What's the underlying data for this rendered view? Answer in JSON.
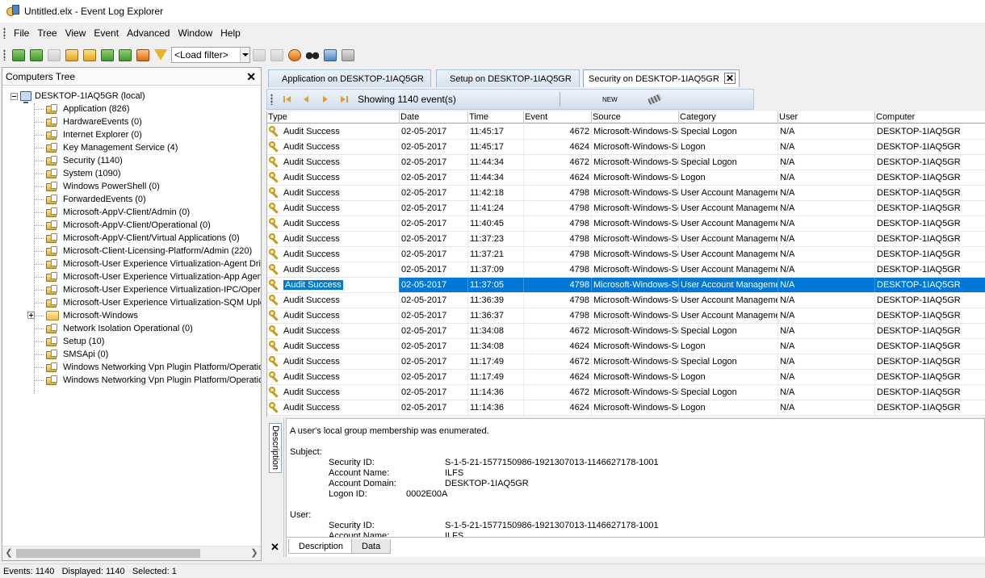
{
  "window": {
    "title": "Untitled.elx - Event Log Explorer"
  },
  "menu": [
    "File",
    "Tree",
    "View",
    "Event",
    "Advanced",
    "Window",
    "Help"
  ],
  "toolbar": {
    "load_filter": "<Load filter>",
    "icons": [
      "add-computer-icon",
      "add-log-icon",
      "remove-icon",
      "open-log-icon",
      "open-folder-icon",
      "save-icon",
      "save-as-icon",
      "delete-icon",
      "filter-icon",
      "clear-filter-icon",
      "clear-log-icon",
      "refresh-icon",
      "find-icon",
      "find-next-icon",
      "print-icon"
    ]
  },
  "computers_tree": {
    "title": "Computers Tree",
    "root": "DESKTOP-1IAQ5GR (local)",
    "items": [
      {
        "label": "Application (826)",
        "kind": "log"
      },
      {
        "label": "HardwareEvents (0)",
        "kind": "log"
      },
      {
        "label": "Internet Explorer (0)",
        "kind": "log"
      },
      {
        "label": "Key Management Service (4)",
        "kind": "log"
      },
      {
        "label": "Security (1140)",
        "kind": "log"
      },
      {
        "label": "System (1090)",
        "kind": "log"
      },
      {
        "label": "Windows PowerShell (0)",
        "kind": "log"
      },
      {
        "label": "ForwardedEvents (0)",
        "kind": "log"
      },
      {
        "label": "Microsoft-AppV-Client/Admin (0)",
        "kind": "log"
      },
      {
        "label": "Microsoft-AppV-Client/Operational (0)",
        "kind": "log"
      },
      {
        "label": "Microsoft-AppV-Client/Virtual Applications (0)",
        "kind": "log"
      },
      {
        "label": "Microsoft-Client-Licensing-Platform/Admin (220)",
        "kind": "log"
      },
      {
        "label": "Microsoft-User Experience Virtualization-Agent Driver",
        "kind": "log"
      },
      {
        "label": "Microsoft-User Experience Virtualization-App Agent/C",
        "kind": "log"
      },
      {
        "label": "Microsoft-User Experience Virtualization-IPC/Operatic",
        "kind": "log"
      },
      {
        "label": "Microsoft-User Experience Virtualization-SQM Uploade",
        "kind": "log"
      },
      {
        "label": "Microsoft-Windows",
        "kind": "folder"
      },
      {
        "label": "Network Isolation Operational (0)",
        "kind": "log"
      },
      {
        "label": "Setup (10)",
        "kind": "log"
      },
      {
        "label": "SMSApi (0)",
        "kind": "log"
      },
      {
        "label": "Windows Networking Vpn Plugin Platform/Operational",
        "kind": "log"
      },
      {
        "label": "Windows Networking Vpn Plugin Platform/Operational",
        "kind": "log"
      }
    ]
  },
  "tabs": [
    {
      "label": "Application on DESKTOP-1IAQ5GR",
      "active": false
    },
    {
      "label": "Setup on DESKTOP-1IAQ5GR",
      "active": false
    },
    {
      "label": "Security on DESKTOP-1IAQ5GR",
      "active": true
    }
  ],
  "event_bar": {
    "showing": "Showing 1140 event(s)",
    "new_label": "NEW"
  },
  "columns": [
    "Type",
    "Date",
    "Time",
    "Event",
    "Source",
    "Category",
    "User",
    "Computer"
  ],
  "events": [
    {
      "type": "Audit Success",
      "date": "02-05-2017",
      "time": "11:45:17",
      "event": "4672",
      "source": "Microsoft-Windows-Se",
      "category": "Special Logon",
      "user": "N/A",
      "computer": "DESKTOP-1IAQ5GR"
    },
    {
      "type": "Audit Success",
      "date": "02-05-2017",
      "time": "11:45:17",
      "event": "4624",
      "source": "Microsoft-Windows-Se",
      "category": "Logon",
      "user": "N/A",
      "computer": "DESKTOP-1IAQ5GR"
    },
    {
      "type": "Audit Success",
      "date": "02-05-2017",
      "time": "11:44:34",
      "event": "4672",
      "source": "Microsoft-Windows-Se",
      "category": "Special Logon",
      "user": "N/A",
      "computer": "DESKTOP-1IAQ5GR"
    },
    {
      "type": "Audit Success",
      "date": "02-05-2017",
      "time": "11:44:34",
      "event": "4624",
      "source": "Microsoft-Windows-Se",
      "category": "Logon",
      "user": "N/A",
      "computer": "DESKTOP-1IAQ5GR"
    },
    {
      "type": "Audit Success",
      "date": "02-05-2017",
      "time": "11:42:18",
      "event": "4798",
      "source": "Microsoft-Windows-Se",
      "category": "User Account Manageme",
      "user": "N/A",
      "computer": "DESKTOP-1IAQ5GR"
    },
    {
      "type": "Audit Success",
      "date": "02-05-2017",
      "time": "11:41:24",
      "event": "4798",
      "source": "Microsoft-Windows-Se",
      "category": "User Account Manageme",
      "user": "N/A",
      "computer": "DESKTOP-1IAQ5GR"
    },
    {
      "type": "Audit Success",
      "date": "02-05-2017",
      "time": "11:40:45",
      "event": "4798",
      "source": "Microsoft-Windows-Se",
      "category": "User Account Manageme",
      "user": "N/A",
      "computer": "DESKTOP-1IAQ5GR"
    },
    {
      "type": "Audit Success",
      "date": "02-05-2017",
      "time": "11:37:23",
      "event": "4798",
      "source": "Microsoft-Windows-Se",
      "category": "User Account Manageme",
      "user": "N/A",
      "computer": "DESKTOP-1IAQ5GR"
    },
    {
      "type": "Audit Success",
      "date": "02-05-2017",
      "time": "11:37:21",
      "event": "4798",
      "source": "Microsoft-Windows-Se",
      "category": "User Account Manageme",
      "user": "N/A",
      "computer": "DESKTOP-1IAQ5GR"
    },
    {
      "type": "Audit Success",
      "date": "02-05-2017",
      "time": "11:37:09",
      "event": "4798",
      "source": "Microsoft-Windows-Se",
      "category": "User Account Manageme",
      "user": "N/A",
      "computer": "DESKTOP-1IAQ5GR"
    },
    {
      "type": "Audit Success",
      "date": "02-05-2017",
      "time": "11:37:05",
      "event": "4798",
      "source": "Microsoft-Windows-Se",
      "category": "User Account Manageme",
      "user": "N/A",
      "computer": "DESKTOP-1IAQ5GR",
      "selected": true
    },
    {
      "type": "Audit Success",
      "date": "02-05-2017",
      "time": "11:36:39",
      "event": "4798",
      "source": "Microsoft-Windows-Se",
      "category": "User Account Manageme",
      "user": "N/A",
      "computer": "DESKTOP-1IAQ5GR"
    },
    {
      "type": "Audit Success",
      "date": "02-05-2017",
      "time": "11:36:37",
      "event": "4798",
      "source": "Microsoft-Windows-Se",
      "category": "User Account Manageme",
      "user": "N/A",
      "computer": "DESKTOP-1IAQ5GR"
    },
    {
      "type": "Audit Success",
      "date": "02-05-2017",
      "time": "11:34:08",
      "event": "4672",
      "source": "Microsoft-Windows-Se",
      "category": "Special Logon",
      "user": "N/A",
      "computer": "DESKTOP-1IAQ5GR"
    },
    {
      "type": "Audit Success",
      "date": "02-05-2017",
      "time": "11:34:08",
      "event": "4624",
      "source": "Microsoft-Windows-Se",
      "category": "Logon",
      "user": "N/A",
      "computer": "DESKTOP-1IAQ5GR"
    },
    {
      "type": "Audit Success",
      "date": "02-05-2017",
      "time": "11:17:49",
      "event": "4672",
      "source": "Microsoft-Windows-Se",
      "category": "Special Logon",
      "user": "N/A",
      "computer": "DESKTOP-1IAQ5GR"
    },
    {
      "type": "Audit Success",
      "date": "02-05-2017",
      "time": "11:17:49",
      "event": "4624",
      "source": "Microsoft-Windows-Se",
      "category": "Logon",
      "user": "N/A",
      "computer": "DESKTOP-1IAQ5GR"
    },
    {
      "type": "Audit Success",
      "date": "02-05-2017",
      "time": "11:14:36",
      "event": "4672",
      "source": "Microsoft-Windows-Se",
      "category": "Special Logon",
      "user": "N/A",
      "computer": "DESKTOP-1IAQ5GR"
    },
    {
      "type": "Audit Success",
      "date": "02-05-2017",
      "time": "11:14:36",
      "event": "4624",
      "source": "Microsoft-Windows-Se",
      "category": "Logon",
      "user": "N/A",
      "computer": "DESKTOP-1IAQ5GR"
    }
  ],
  "description": {
    "side_label": "Description",
    "summary": "A user's local group membership was enumerated.",
    "subject_heading": "Subject:",
    "subject": [
      {
        "key": "Security ID:",
        "value": "S-1-5-21-1577150986-1921307013-1146627178-1001"
      },
      {
        "key": "Account Name:",
        "value": "ILFS"
      },
      {
        "key": "Account Domain:",
        "value": "DESKTOP-1IAQ5GR"
      },
      {
        "key": "Logon ID:",
        "value": "0002E00A"
      }
    ],
    "user_heading": "User:",
    "user": [
      {
        "key": "Security ID:",
        "value": "S-1-5-21-1577150986-1921307013-1146627178-1001"
      },
      {
        "key": "Account Name:",
        "value": "ILFS"
      }
    ],
    "tabs": [
      "Description",
      "Data"
    ]
  },
  "status": {
    "events": "Events: 1140",
    "displayed": "Displayed: 1140",
    "selected": "Selected: 1"
  }
}
